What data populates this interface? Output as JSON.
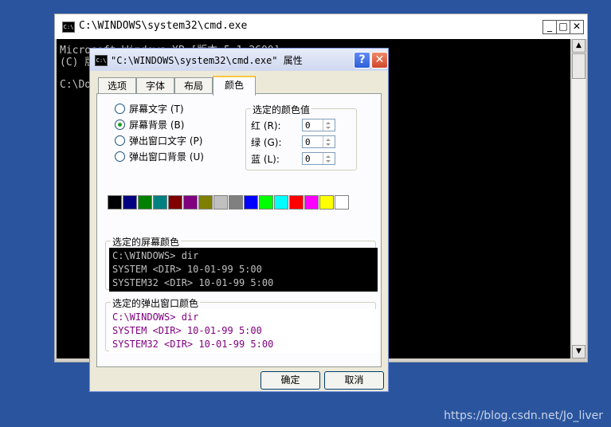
{
  "cmd_window": {
    "title": "C:\\WINDOWS\\system32\\cmd.exe",
    "icon_text": "C:\\",
    "lines": [
      "Microsoft Windows XP [版本 5.1.2600]",
      "(C) 版",
      "C:\\Do"
    ],
    "minimize": "_",
    "maximize": "□",
    "close": "✕"
  },
  "dialog": {
    "title": "\"C:\\WINDOWS\\system32\\cmd.exe\" 属性",
    "icon_text": "C:\\",
    "help": "?",
    "close": "✕",
    "tabs": [
      "选项",
      "字体",
      "布局",
      "颜色"
    ],
    "active_tab": "颜色",
    "radios": [
      {
        "label": "屏幕文字 (T)",
        "checked": false
      },
      {
        "label": "屏幕背景 (B)",
        "checked": true
      },
      {
        "label": "弹出窗口文字 (P)",
        "checked": false
      },
      {
        "label": "弹出窗口背景 (U)",
        "checked": false
      }
    ],
    "color_values": {
      "title": "选定的颜色值",
      "red_label": "红 (R):",
      "red": "0",
      "green_label": "绿 (G):",
      "green": "0",
      "blue_label": "蓝 (L):",
      "blue": "0"
    },
    "palette": [
      "#000000",
      "#000080",
      "#008000",
      "#008080",
      "#800000",
      "#800080",
      "#808000",
      "#c0c0c0",
      "#808080",
      "#0000ff",
      "#00ff00",
      "#00ffff",
      "#ff0000",
      "#ff00ff",
      "#ffff00",
      "#ffffff"
    ],
    "screen_preview": {
      "title": "选定的屏幕颜色",
      "bg": "#000000",
      "fg": "#c0c0c0",
      "line1": "C:\\WINDOWS> dir",
      "line2": "SYSTEM       <DIR>      10-01-99    5:00",
      "line3": "SYSTEM32     <DIR>      10-01-99    5:00"
    },
    "popup_preview": {
      "title": "选定的弹出窗口颜色",
      "bg": "#ffffff",
      "fg": "#800080",
      "line1": "C:\\WINDOWS> dir",
      "line2": "SYSTEM       <DIR>      10-01-99    5:00",
      "line3": "SYSTEM32     <DIR>      10-01-99    5:00"
    },
    "ok": "确定",
    "cancel": "取消"
  },
  "watermark": "https://blog.csdn.net/Jo_liver"
}
